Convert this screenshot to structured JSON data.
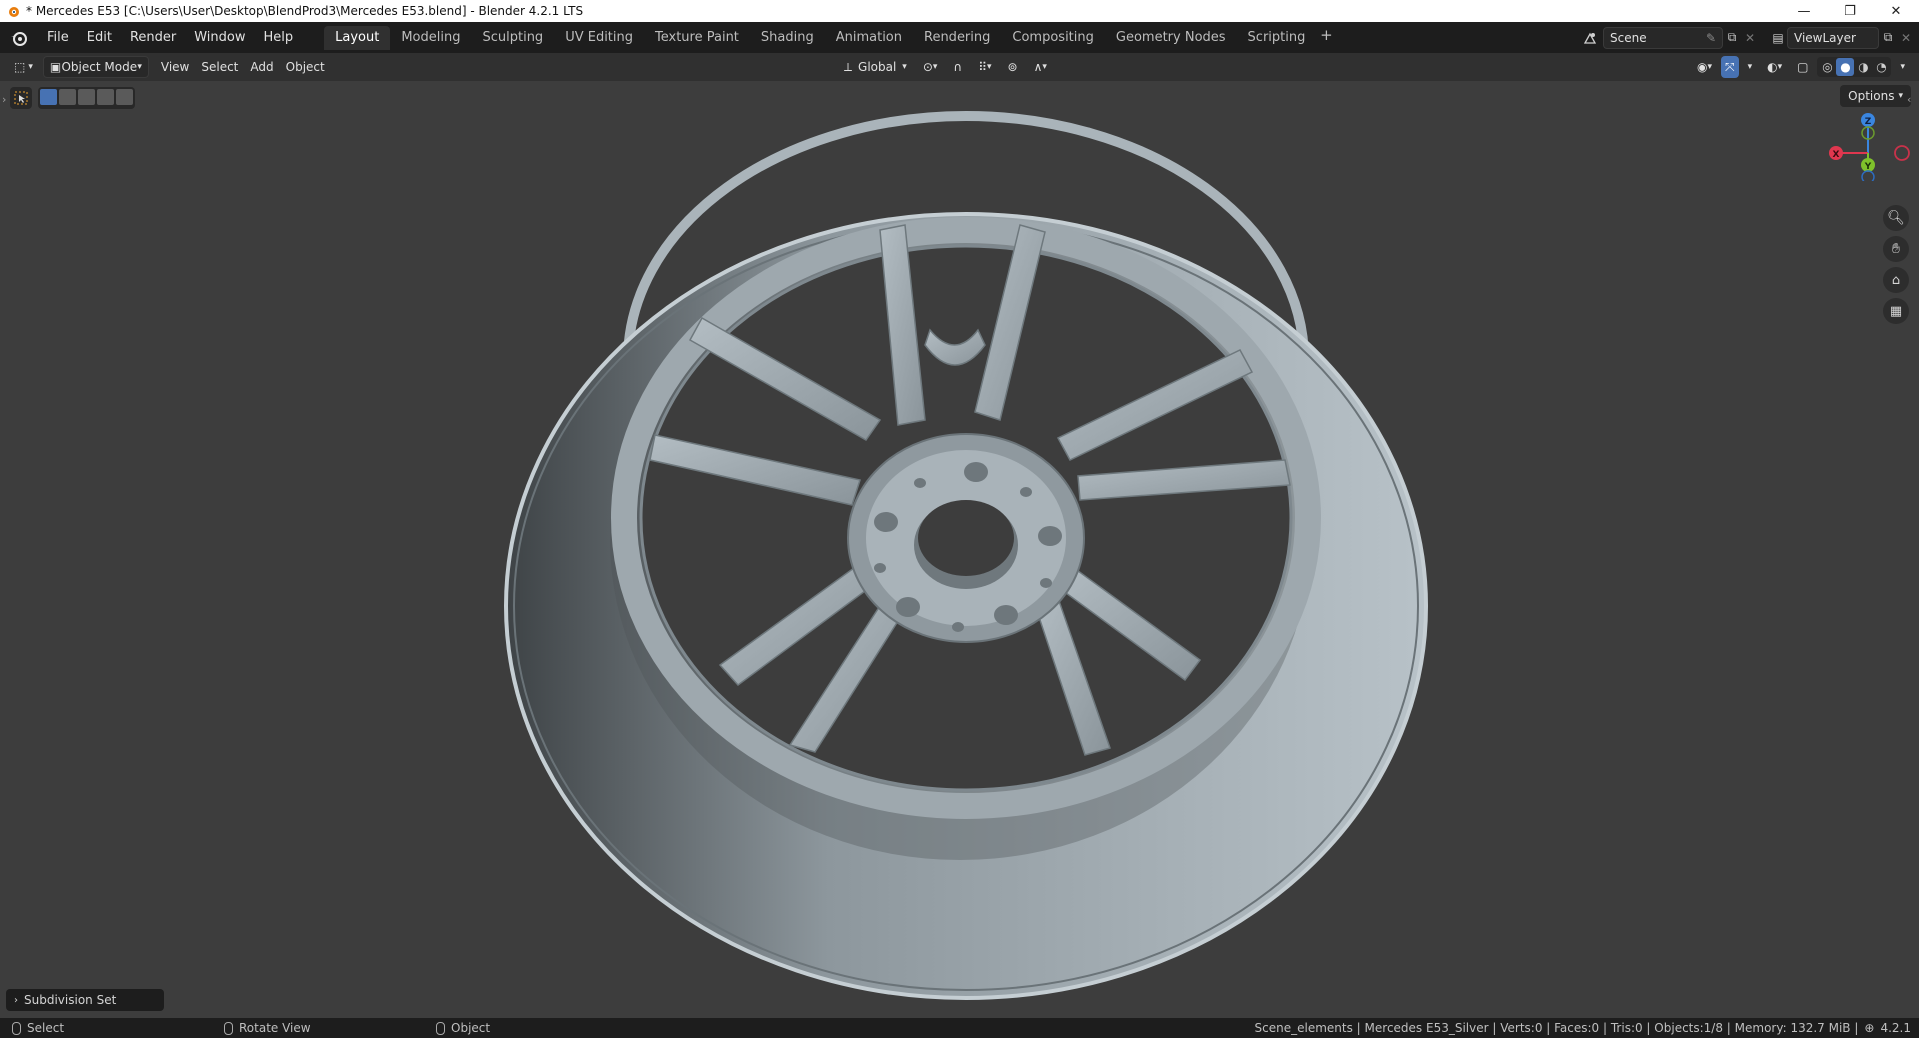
{
  "window": {
    "title": "* Mercedes E53 [C:\\Users\\User\\Desktop\\BlendProd3\\Mercedes E53.blend] - Blender 4.2.1 LTS",
    "minimize": "—",
    "restore": "❐",
    "close": "✕"
  },
  "menu": {
    "items": [
      "File",
      "Edit",
      "Render",
      "Window",
      "Help"
    ]
  },
  "workspaces": {
    "tabs": [
      "Layout",
      "Modeling",
      "Sculpting",
      "UV Editing",
      "Texture Paint",
      "Shading",
      "Animation",
      "Rendering",
      "Compositing",
      "Geometry Nodes",
      "Scripting"
    ],
    "active": "Layout",
    "add": "+"
  },
  "scene": {
    "name": "Scene"
  },
  "view_layer": {
    "name": "ViewLayer"
  },
  "viewport_header": {
    "mode": "Object Mode",
    "menus": [
      "View",
      "Select",
      "Add",
      "Object"
    ],
    "transform_orientation": "Global"
  },
  "viewport": {
    "options_label": "Options",
    "gizmo": {
      "z": "Z",
      "x": "X",
      "y": "Y"
    },
    "last_operation": "Subdivision Set"
  },
  "statusbar": {
    "select": "Select",
    "rotate": "Rotate View",
    "object": "Object",
    "stats": "Scene_elements | Mercedes E53_Silver | Verts:0 | Faces:0 | Tris:0 | Objects:1/8 | Memory: 132.7 MiB |",
    "version": "4.2.1"
  },
  "colors": {
    "accent_blue": "#4772b3",
    "axis_x": "#e0374f",
    "axis_y": "#7fc22b",
    "axis_z": "#3a86e0"
  }
}
